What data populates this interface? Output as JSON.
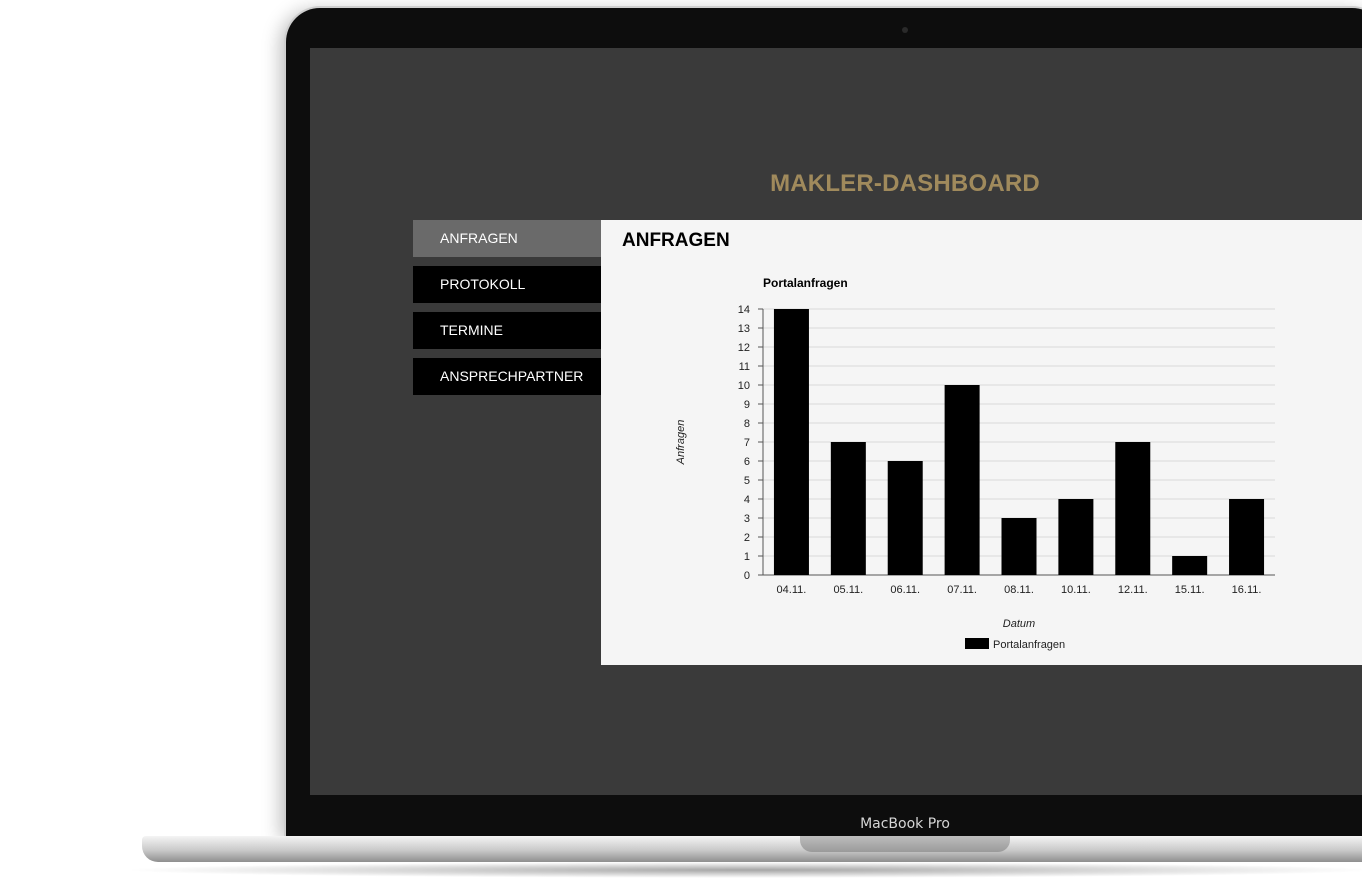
{
  "header": {
    "title": "MAKLER-DASHBOARD"
  },
  "nav": {
    "items": [
      {
        "label": "ANFRAGEN",
        "active": true
      },
      {
        "label": "PROTOKOLL",
        "active": false
      },
      {
        "label": "TERMINE",
        "active": false
      },
      {
        "label": "ANSPRECHPARTNER",
        "active": false
      }
    ]
  },
  "main": {
    "title": "ANFRAGEN"
  },
  "device": {
    "label": "MacBook Pro"
  },
  "colors": {
    "accent": "#a08a5c",
    "screen_bg": "#3a3a3a",
    "nav_active": "#6a6a6a",
    "bar": "#000000"
  },
  "chart_data": {
    "type": "bar",
    "title": "Portalanfragen",
    "xlabel": "Datum",
    "ylabel": "Anfragen",
    "categories": [
      "04.11.",
      "05.11.",
      "06.11.",
      "07.11.",
      "08.11.",
      "10.11.",
      "12.11.",
      "15.11.",
      "16.11."
    ],
    "series": [
      {
        "name": "Portalanfragen",
        "values": [
          14,
          7,
          6,
          10,
          3,
          4,
          7,
          1,
          4
        ]
      }
    ],
    "ylim": [
      0,
      14
    ],
    "yticks": [
      0,
      1,
      2,
      3,
      4,
      5,
      6,
      7,
      8,
      9,
      10,
      11,
      12,
      13,
      14
    ],
    "grid": true,
    "legend": "bottom"
  }
}
